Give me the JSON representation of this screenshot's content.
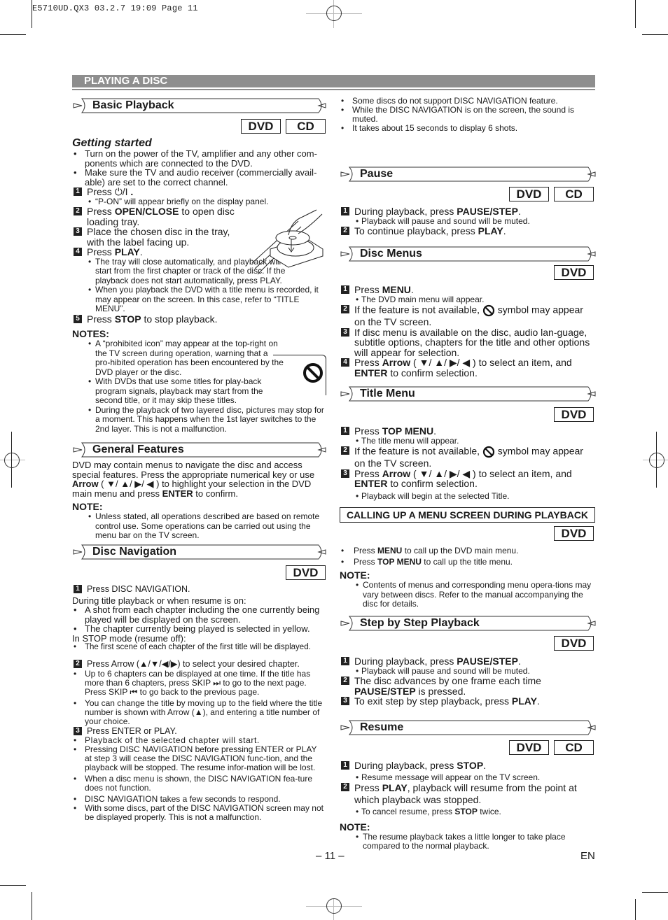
{
  "slug": "E5710UD.QX3  03.2.7 19:09  Page 11",
  "banner": "PLAYING A DISC",
  "badges": {
    "dvd": "DVD",
    "cd": "CD"
  },
  "basic_playback": {
    "heading": "Basic Playback",
    "subheading": "Getting started",
    "bullets": [
      "Turn on the power of the TV, amplifier and any other com-ponents which are connected to the DVD.",
      "Make sure the TV and audio receiver (commercially avail-able) are set to the correct channel."
    ],
    "step1": {
      "pre": "Press ",
      "key": "⏻/I",
      "post": " ."
    },
    "step1_sub": "“P-ON” will appear briefly on the display panel.",
    "step2": {
      "pre": "Press ",
      "key": "OPEN/CLOSE",
      "post": " to open disc loading tray."
    },
    "step3": "Place the chosen disc in the tray, with the label facing up.",
    "step4": {
      "pre": "Press ",
      "key": "PLAY",
      "post": "."
    },
    "step4_subs": [
      "The tray will close automatically, and playback will then start from the first chapter or track of the disc. If the playback does not start automatically, press PLAY.",
      "When you playback the DVD with a title menu is recorded, it may appear on the screen. In this case, refer to “TITLE MENU”."
    ],
    "step5": {
      "pre": "Press ",
      "key": "STOP",
      "post": " to stop playback."
    },
    "notes_heading": "NOTES:",
    "notes": [
      "A “prohibited icon” may appear at the top-right on the TV screen during operation, warning that a pro-hibited operation has been encountered by the DVD player or the disc.",
      "With DVDs that use some titles for play-back program signals, playback may start from the second title, or it may skip these titles.",
      "During the playback of two layered disc, pictures may stop for a moment. This happens when the 1st layer switches to the 2nd layer. This is not a malfunction."
    ]
  },
  "general_features": {
    "heading": "General Features",
    "body_1": "DVD may contain menus to navigate the disc and access special features. Press the appropriate numerical key or use ",
    "arrow_key": "Arrow",
    "body_2": " ( ▼/ ▲/ ▶/ ◀ ) to highlight your selection in the DVD main menu and press ",
    "enter_key": "ENTER",
    "body_3": " to confirm.",
    "note_heading": "NOTE:",
    "note": "Unless stated, all operations described are based on remote control use. Some operations can be carried out using the menu bar on the TV screen."
  },
  "disc_navigation": {
    "heading": "Disc Navigation",
    "step1": "Press DISC NAVIGATION.",
    "during_label": "During title playback or when resume is on:",
    "during_bullets": [
      "A shot from each chapter including the one currently being played will be displayed on the screen.",
      "The chapter currently being played is selected in yellow."
    ],
    "stop_label": "In STOP mode (resume off):",
    "stop_bullets": [
      "The first scene of each chapter of the first title will be displayed."
    ],
    "step2": "Press Arrow (▲/▼/◀/▶) to select your desired chapter.",
    "step2_bullets": [
      "Up to 6 chapters can be displayed at one time.  If the title has more than 6 chapters, press SKIP ⏭ to go to the next page.  Press SKIP ⏮ to go back to the previous page.",
      "You can change the title by moving up to the field where the title number is shown with Arrow (▲), and entering a title number of your choice."
    ],
    "step3": "Press ENTER or PLAY.",
    "step3_bullets": [
      "Playback of the selected chapter will start.",
      "Pressing DISC NAVIGATION before pressing ENTER or PLAY at step 3 will cease the DISC NAVIGATION func-tion, and the playback will be stopped.  The resume infor-mation will be lost.",
      "When a disc menu is shown, the DISC NAVIGATION fea-ture does not function.",
      "DISC NAVIGATION takes a few seconds to respond.",
      "With some discs, part of the DISC NAVIGATION screen may not be displayed properly.  This is not a malfunction."
    ],
    "extra_bullets": [
      "Some discs do not support DISC NAVIGATION feature.",
      "While the DISC NAVIGATION is on the screen, the sound is muted.",
      "It takes about 15 seconds to display 6 shots."
    ]
  },
  "pause": {
    "heading": "Pause",
    "step1": {
      "pre": "During playback, press ",
      "key": "PAUSE/STEP",
      "post": "."
    },
    "step1_sub": "Playback will pause and sound will be muted.",
    "step2": {
      "pre": "To continue playback, press ",
      "key": "PLAY",
      "post": "."
    }
  },
  "disc_menus": {
    "heading": "Disc Menus",
    "step1": {
      "pre": "Press ",
      "key": "MENU",
      "post": "."
    },
    "step1_sub": "The DVD main menu will appear.",
    "step2_a": "If the feature is not available, ",
    "step2_b": " symbol may appear on the TV screen.",
    "step3": "If disc menu is available on the disc, audio lan-guage, subtitle options, chapters for the title and other options will appear for selection.",
    "step4": {
      "pre": "Press ",
      "key": "Arrow",
      "mid": " ( ▼/ ▲/ ▶/ ◀ ) to select an item, and ",
      "key2": "ENTER",
      "post": " to confirm selection."
    }
  },
  "title_menu": {
    "heading": "Title Menu",
    "step1": {
      "pre": "Press ",
      "key": "TOP MENU",
      "post": "."
    },
    "step1_sub": "The title menu will appear.",
    "step2_a": "If the feature is not available, ",
    "step2_b": " symbol may appear on the TV screen.",
    "step3": {
      "pre": "Press ",
      "key": "Arrow",
      "mid": " ( ▼/ ▲/ ▶/ ◀ ) to select an item, and ",
      "key2": "ENTER",
      "post": " to confirm selection."
    },
    "step3_sub": "Playback will begin at the selected Title."
  },
  "calling_up": {
    "heading": "CALLING UP A MENU SCREEN DURING PLAYBACK",
    "bullet1": {
      "pre": "Press ",
      "key": "MENU",
      "post": " to call up the DVD main menu."
    },
    "bullet2": {
      "pre": "Press ",
      "key": "TOP MENU",
      "post": " to call up the title menu."
    },
    "note_heading": "NOTE:",
    "note": "Contents of menus and corresponding menu opera-tions may vary between discs. Refer to the manual accompanying the disc for details."
  },
  "step_by_step": {
    "heading": "Step by Step Playback",
    "step1": {
      "pre": "During playback, press ",
      "key": "PAUSE/STEP",
      "post": "."
    },
    "step1_sub": "Playback will pause and sound will be muted.",
    "step2": {
      "pre": "The disc advances by one frame each time ",
      "key": "PAUSE/STEP",
      "post": " is pressed."
    },
    "step3": {
      "pre": "To exit step by step playback, press ",
      "key": "PLAY",
      "post": "."
    }
  },
  "resume": {
    "heading": "Resume",
    "step1": {
      "pre": "During playback, press ",
      "key": "STOP",
      "post": "."
    },
    "step1_sub": "Resume message will appear on the TV screen.",
    "step2": {
      "pre": "Press ",
      "key": "PLAY",
      "post": ", playback will resume from the point at which playback was stopped."
    },
    "step2_sub": {
      "pre": "To cancel resume, press ",
      "key": "STOP",
      "post": " twice."
    },
    "note_heading": "NOTE:",
    "note": "The resume playback takes a little longer to take place compared to the normal playback."
  },
  "footer": {
    "page": "– 11 –",
    "lang": "EN"
  }
}
